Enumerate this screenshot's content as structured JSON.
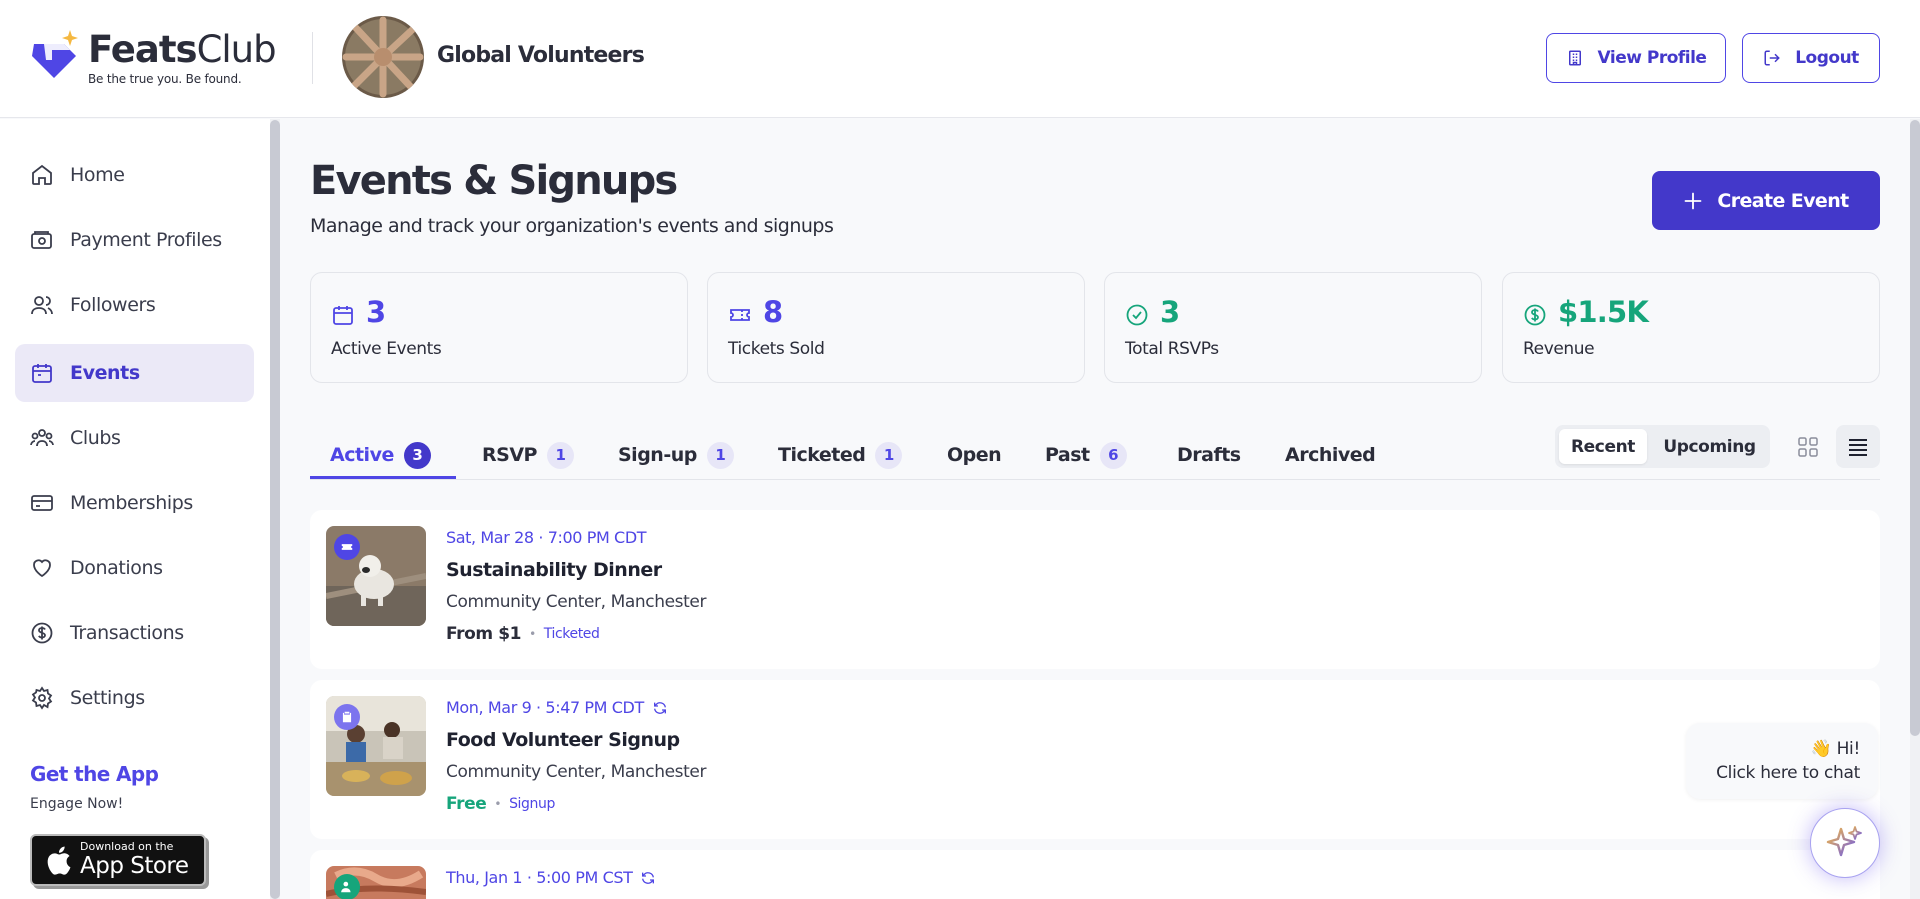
{
  "brand": {
    "name_bold": "Feats",
    "name_thin": "Club",
    "tagline": "Be the true you. Be found.",
    "accent": "#4f46e5"
  },
  "org": {
    "name": "Global Volunteers"
  },
  "header": {
    "view_profile": "View Profile",
    "logout": "Logout"
  },
  "sidebar": {
    "items": [
      {
        "label": "Home",
        "icon": "home-icon"
      },
      {
        "label": "Payment Profiles",
        "icon": "wallet-icon"
      },
      {
        "label": "Followers",
        "icon": "users-icon"
      },
      {
        "label": "Events",
        "icon": "calendar-icon",
        "active": true
      },
      {
        "label": "Clubs",
        "icon": "group-icon"
      },
      {
        "label": "Memberships",
        "icon": "card-icon"
      },
      {
        "label": "Donations",
        "icon": "heart-icon"
      },
      {
        "label": "Transactions",
        "icon": "dollar-circle-icon"
      },
      {
        "label": "Settings",
        "icon": "gear-icon"
      }
    ],
    "get_app": {
      "title": "Get the App",
      "subtitle": "Engage Now!",
      "store_small": "Download on the",
      "store_big": "App Store"
    }
  },
  "page": {
    "title": "Events & Signups",
    "subtitle": "Manage and track your organization's events and signups",
    "create_label": "Create Event"
  },
  "stats": [
    {
      "value": "3",
      "label": "Active Events"
    },
    {
      "value": "8",
      "label": "Tickets Sold"
    },
    {
      "value": "3",
      "label": "Total RSVPs"
    },
    {
      "value": "$1.5K",
      "label": "Revenue"
    }
  ],
  "tabs": [
    {
      "label": "Active",
      "count": "3"
    },
    {
      "label": "RSVP",
      "count": "1"
    },
    {
      "label": "Sign-up",
      "count": "1"
    },
    {
      "label": "Ticketed",
      "count": "1"
    },
    {
      "label": "Open"
    },
    {
      "label": "Past",
      "count": "6"
    },
    {
      "label": "Drafts"
    },
    {
      "label": "Archived"
    }
  ],
  "sort": {
    "recent": "Recent",
    "upcoming": "Upcoming"
  },
  "events": [
    {
      "date": "Sat, Mar 28 · 7:00 PM CDT",
      "title": "Sustainability Dinner",
      "location": "Community Center, Manchester",
      "price": "From $1",
      "kind": "Ticketed"
    },
    {
      "date": "Mon, Mar 9 · 5:47 PM CDT",
      "title": "Food Volunteer Signup",
      "location": "Community Center, Manchester",
      "price": "Free",
      "kind": "Signup"
    },
    {
      "date": "Thu, Jan 1 · 5:00 PM CST"
    }
  ],
  "chat": {
    "greeting": "👋 Hi!",
    "prompt": "Click here to chat"
  }
}
